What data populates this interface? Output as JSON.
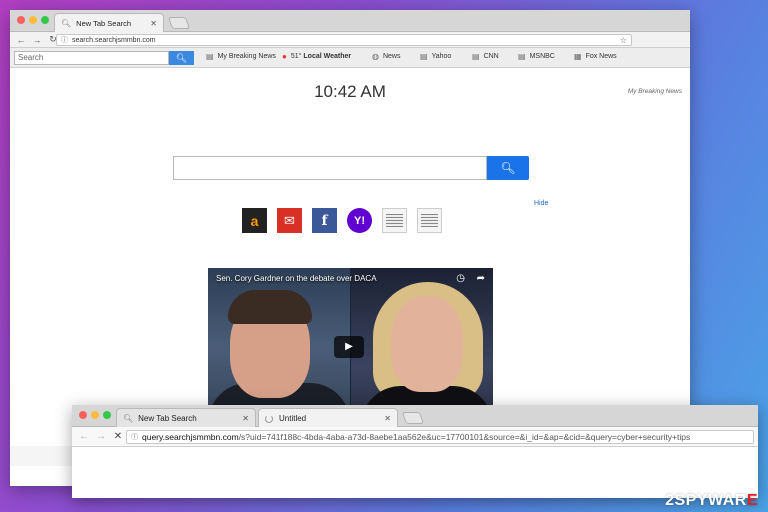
{
  "window1": {
    "tab_title": "New Tab Search",
    "url": "search.searchjsmmbn.com",
    "toolbar": {
      "search_placeholder": "Search",
      "items": [
        {
          "label": "My Breaking News",
          "icon": "newspaper-icon"
        },
        {
          "label": "51°",
          "bold": "Local Weather",
          "icon": "weather-icon"
        },
        {
          "label": "News",
          "icon": "globe-icon"
        },
        {
          "label": "Yahoo",
          "icon": "newspaper-icon"
        },
        {
          "label": "CNN",
          "icon": "newspaper-icon"
        },
        {
          "label": "MSNBC",
          "icon": "newspaper-icon"
        },
        {
          "label": "Fox News",
          "icon": "calendar-icon"
        }
      ]
    },
    "clock": "10:42 AM",
    "brand": "My Breaking News",
    "hide_label": "Hide",
    "video": {
      "title": "Sen. Cory Gardner on the debate over DACA"
    }
  },
  "window2": {
    "tabs": [
      {
        "label": "New Tab Search"
      },
      {
        "label": "Untitled"
      }
    ],
    "url_host": "query.searchjsmmbn.com",
    "url_path": "/s?uid=741f188c-4bda-4aba-a73d-8aebe1aa562e&uc=17700101&source=&i_id=&ap=&cid=&query=cyber+security+tips"
  },
  "watermark": {
    "pre": "2SPYWAR",
    "red": "E"
  },
  "colors": {
    "search_button": "#1a73e8",
    "toolbar_button": "#3b88e0",
    "link": "#2a6fc9"
  }
}
